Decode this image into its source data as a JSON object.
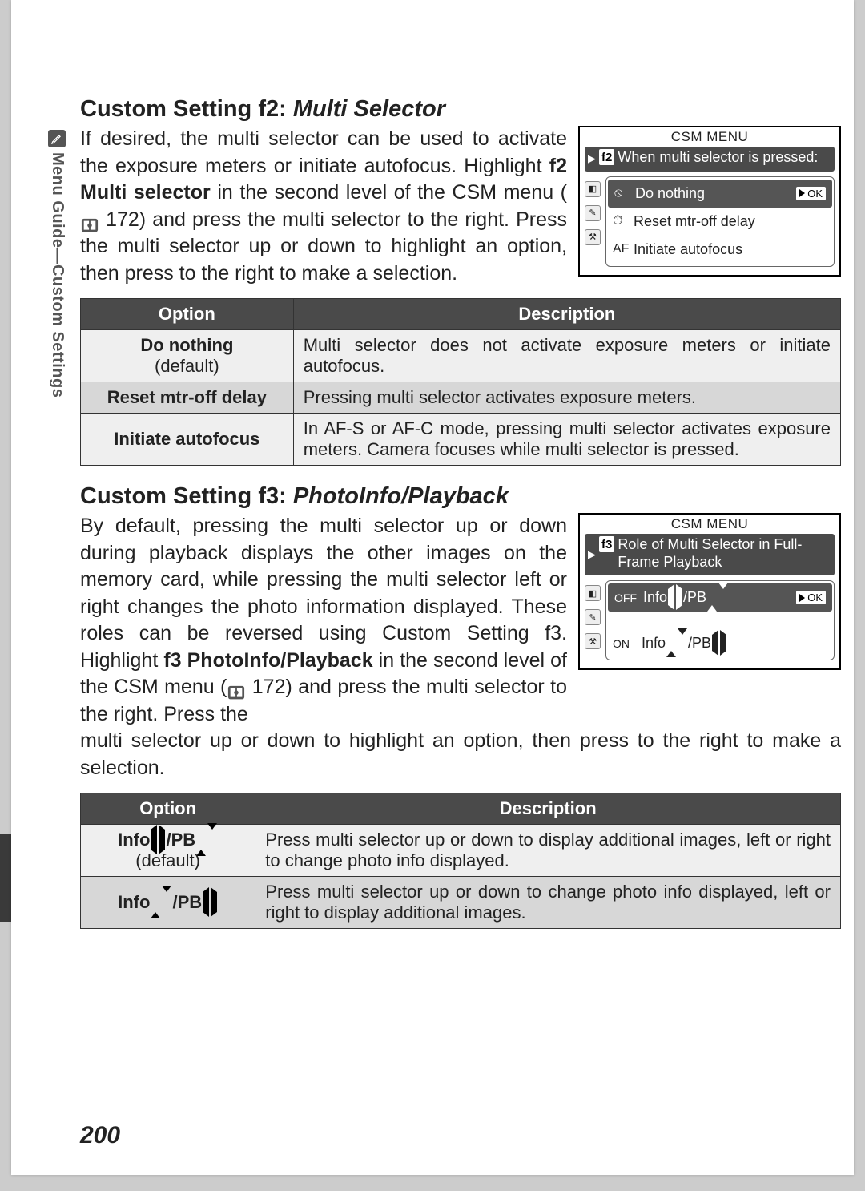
{
  "side_tab": "Menu Guide—Custom Settings",
  "page_number": "200",
  "section_f2": {
    "title_prefix": "Custom Setting f2: ",
    "title_italic": "Multi Selector",
    "para_a": "If desired, the multi selector can be used to activate the exposure meters or initiate autofocus. Highlight ",
    "para_b_bold": "f2 Multi selector",
    "para_c": " in the second level of the CSM menu (",
    "manual_ref": " 172) and press the multi selector to the right.  Press the multi selector up or down to highlight an option, then press to the right to make a selection.",
    "screen": {
      "title": "CSM MENU",
      "code": "f2",
      "heading": "When multi selector is pressed:",
      "items": [
        {
          "icon": "⦸",
          "label": "Do nothing",
          "selected": true
        },
        {
          "icon": "⏱",
          "label": "Reset mtr-off delay",
          "selected": false
        },
        {
          "icon": "AF",
          "label": "Initiate autofocus",
          "selected": false
        }
      ]
    },
    "table": {
      "h1": "Option",
      "h2": "Description",
      "rows": [
        {
          "opt": "Do nothing",
          "def": "(default)",
          "desc": "Multi selector does not activate exposure meters or initiate autofocus."
        },
        {
          "opt": "Reset mtr-off delay",
          "desc": "Pressing multi selector activates exposure meters."
        },
        {
          "opt": "Initiate autofocus",
          "desc": "In AF-S or AF-C mode, pressing multi selector activates exposure meters.  Camera focuses while multi selector is pressed."
        }
      ]
    }
  },
  "section_f3": {
    "title_prefix": "Custom Setting f3: ",
    "title_italic": "PhotoInfo/Playback",
    "para_a": "By default, pressing the multi selector up or down during playback displays the other images on the memory card, while pressing the multi selector left or right changes the photo information displayed.  These roles can be reversed using Custom Setting f3.  Highlight ",
    "para_b_bold": "f3 PhotoInfo/Playback",
    "para_c": " in the second level of the CSM menu (",
    "manual_ref": " 172) and press the multi selector to the right.  Press the ",
    "para_after": "multi selector up or down to highlight an option, then press to the right to make a selection.",
    "screen": {
      "title": "CSM MENU",
      "code": "f3",
      "heading": "Role of Multi Selector in Full-Frame Playback",
      "items": [
        {
          "onoff": "OFF",
          "info": "lr",
          "pb": "ud",
          "selected": true
        },
        {
          "onoff": "ON",
          "info": "ud",
          "pb": "lr",
          "selected": false
        }
      ]
    },
    "table": {
      "h1": "Option",
      "h2": "Description",
      "rows": [
        {
          "opt_info": "lr",
          "opt_pb": "ud",
          "def": "(default)",
          "desc": "Press multi selector up or down to display additional images, left or right to change photo info displayed."
        },
        {
          "opt_info": "ud",
          "opt_pb": "lr",
          "desc": "Press multi selector up or down to change photo info displayed, left or right to display additional images."
        }
      ]
    }
  }
}
